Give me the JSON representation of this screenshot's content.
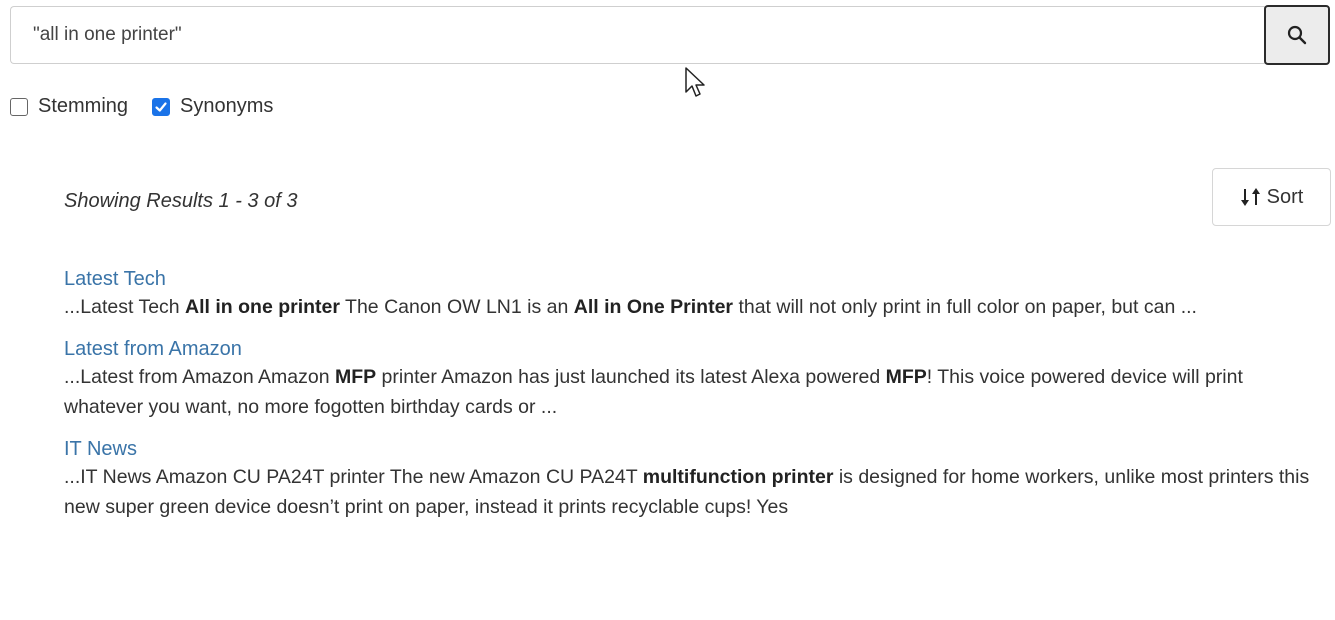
{
  "search": {
    "query": "\"all in one printer\"",
    "button_icon": "search-icon"
  },
  "options": {
    "stemming": {
      "label": "Stemming",
      "checked": false
    },
    "synonyms": {
      "label": "Synonyms",
      "checked": true
    },
    "checked_color": "#1a73e8"
  },
  "results_header": {
    "summary": "Showing Results 1 - 3 of 3",
    "sort_label": "Sort",
    "sort_icon": "sort-arrows-icon"
  },
  "results": [
    {
      "title": "Latest Tech",
      "snippet": [
        {
          "text": "...Latest Tech ",
          "bold": false
        },
        {
          "text": "All in one printer",
          "bold": true
        },
        {
          "text": " The Canon OW LN1 is an ",
          "bold": false
        },
        {
          "text": "All in One Printer",
          "bold": true
        },
        {
          "text": " that will not only print in full color on paper, but can ...",
          "bold": false
        }
      ]
    },
    {
      "title": "Latest from Amazon",
      "snippet": [
        {
          "text": "...Latest from Amazon Amazon ",
          "bold": false
        },
        {
          "text": "MFP",
          "bold": true
        },
        {
          "text": " printer Amazon has just launched its latest Alexa powered ",
          "bold": false
        },
        {
          "text": "MFP",
          "bold": true
        },
        {
          "text": "! This voice powered device will print whatever you want, no more fogotten birthday cards or ...",
          "bold": false
        }
      ]
    },
    {
      "title": "IT News",
      "snippet": [
        {
          "text": "...IT News Amazon CU PA24T printer The new Amazon CU PA24T ",
          "bold": false
        },
        {
          "text": "multifunction printer",
          "bold": true
        },
        {
          "text": " is designed for home workers, unlike most printers this new super green device doesn’t print on paper, instead it prints recyclable cups! Yes",
          "bold": false
        }
      ]
    }
  ],
  "colors": {
    "link": "#3a74a8",
    "text": "#333333"
  }
}
